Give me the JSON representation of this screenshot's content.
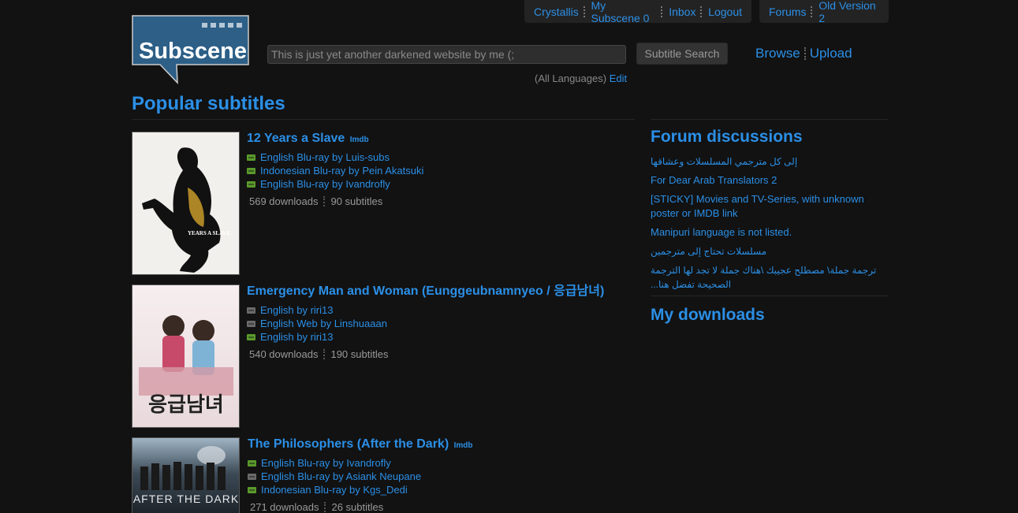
{
  "user_bar": {
    "username": "Crystallis",
    "my_subscene": "My Subscene 0",
    "inbox": "Inbox",
    "logout": "Logout"
  },
  "forum_bar": {
    "forums": "Forums",
    "old_version": "Old Version 2"
  },
  "logo": {
    "text": "Subscene"
  },
  "search": {
    "value": "This is just yet another darkened website by me (;",
    "button": "Subtitle Search",
    "languages": "(All Languages)",
    "edit": "Edit"
  },
  "nav": {
    "browse": "Browse",
    "upload": "Upload"
  },
  "popular": {
    "heading": "Popular subtitles",
    "movies": [
      {
        "title": "12 Years a Slave",
        "imdb": "Imdb",
        "subtitles": [
          {
            "label": "English Blu-ray by Luis-subs",
            "rating": "good"
          },
          {
            "label": "Indonesian Blu-ray by Pein Akatsuki",
            "rating": "good"
          },
          {
            "label": "English Blu-ray by Ivandrofly",
            "rating": "good"
          }
        ],
        "downloads": "569 downloads",
        "count": "90 subtitles",
        "poster_text": "YEARS A SLAVE"
      },
      {
        "title": "Emergency Man and Woman (Eunggeubnamnyeo / 응급남녀)",
        "imdb": "",
        "subtitles": [
          {
            "label": "English by riri13",
            "rating": "neutral"
          },
          {
            "label": "English Web by Linshuaaan",
            "rating": "neutral"
          },
          {
            "label": "English by riri13",
            "rating": "good"
          }
        ],
        "downloads": "540 downloads",
        "count": "190 subtitles",
        "poster_text": "응급남녀"
      },
      {
        "title": "The Philosophers (After the Dark)",
        "imdb": "Imdb",
        "subtitles": [
          {
            "label": "English Blu-ray by Ivandrofly",
            "rating": "good"
          },
          {
            "label": "English Blu-ray by Asiank Neupane",
            "rating": "neutral"
          },
          {
            "label": "Indonesian Blu-ray by Kgs_Dedi",
            "rating": "good"
          }
        ],
        "downloads": "271 downloads",
        "count": "26 subtitles",
        "poster_text": "AFTER THE DARK"
      }
    ]
  },
  "forum": {
    "heading": "Forum discussions",
    "items": [
      {
        "text": "إلى كل مترجمي المسلسلات وعشاقها",
        "rtl": true
      },
      {
        "text": "For Dear Arab Translators 2",
        "rtl": false
      },
      {
        "text": "[STICKY] Movies and TV-Series, with unknown poster or IMDB link",
        "rtl": false
      },
      {
        "text": "Manipuri language is not listed.",
        "rtl": false
      },
      {
        "text": "مسلسلات تحتاج إلى مترجمين",
        "rtl": true
      },
      {
        "text": "ترجمة جملة\\ مصطلح عجيبك \\هناك جملة لا تجد لها الترجمة الصحيحة تفضل هنا...",
        "rtl": true
      }
    ]
  },
  "downloads": {
    "heading": "My downloads"
  },
  "colors": {
    "background": "#121212",
    "link": "#2b8fe6",
    "rating_good": "#5a9a2a",
    "rating_neutral": "#6a6a6a"
  }
}
